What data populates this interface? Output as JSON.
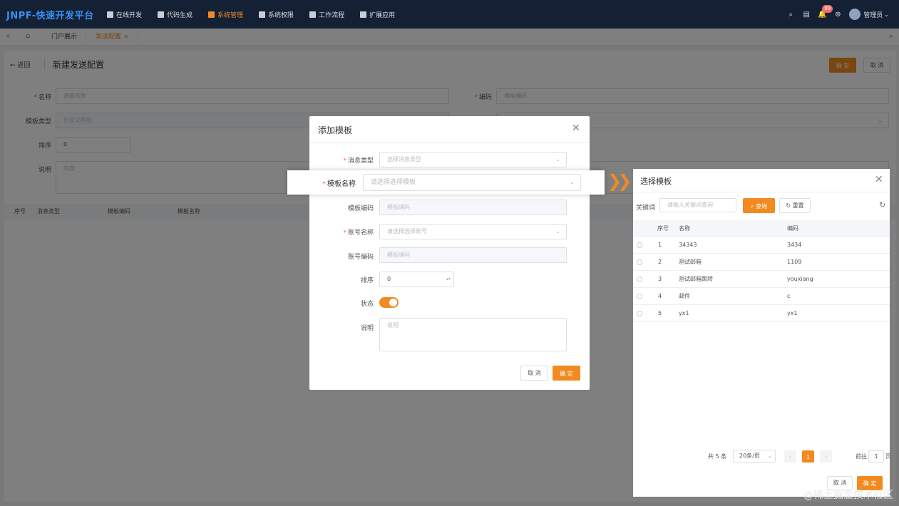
{
  "topbar": {
    "logo": "JNPF-快速开发平台",
    "nav": [
      "在线开发",
      "代码生成",
      "系统管理",
      "系统权限",
      "工作流程",
      "扩展应用"
    ],
    "active_index": 2,
    "notification_count": "99",
    "user": "管理员"
  },
  "tabs": [
    "门户展示",
    "发送配置"
  ],
  "page": {
    "back": "返回",
    "title": "新建发送配置",
    "confirm": "确 定",
    "cancel": "取 消",
    "form": {
      "name_label": "名称",
      "name_placeholder": "请输名称",
      "code_label": "编码",
      "code_placeholder": "模板编码",
      "template_type_label": "模板类型",
      "template_type_value": "自定义模板",
      "sort_label": "排序",
      "sort_value": "0",
      "desc_label": "说明",
      "desc_placeholder": "内容"
    },
    "table_headers": [
      "序号",
      "消息类型",
      "模板编码",
      "模板名称"
    ]
  },
  "dialog": {
    "title": "添加模板",
    "msg_type_label": "消息类型",
    "msg_type_placeholder": "选择消息类型",
    "tpl_name_label": "模板名称",
    "tpl_name_placeholder": "请选择选择模板",
    "tpl_code_label": "模板编码",
    "tpl_code_placeholder": "模板编码",
    "account_name_label": "账号名称",
    "account_name_placeholder": "请选择选择账号",
    "account_code_label": "账号编码",
    "account_code_placeholder": "模板编码",
    "sort_label": "排序",
    "sort_value": "0",
    "status_label": "状态",
    "status_on": true,
    "desc_label": "说明",
    "desc_placeholder": "说明",
    "cancel": "取 消",
    "confirm": "确 定"
  },
  "select_panel": {
    "title": "选择模板",
    "keyword_label": "关键词",
    "keyword_placeholder": "请输入关键词查询",
    "search": "查询",
    "reset": "重置",
    "headers": [
      "序号",
      "名称",
      "编码"
    ],
    "rows": [
      {
        "idx": "1",
        "name": "34343",
        "code": "3434"
      },
      {
        "idx": "2",
        "name": "测试邮箱",
        "code": "1109"
      },
      {
        "idx": "3",
        "name": "测试邮箱跳转",
        "code": "youxiang"
      },
      {
        "idx": "4",
        "name": "邮件",
        "code": "c"
      },
      {
        "idx": "5",
        "name": "yx1",
        "code": "yx1"
      }
    ],
    "total": "共 5 条",
    "page_size": "20条/页",
    "current_page": "1",
    "goto_label": "前往",
    "goto_value": "1",
    "page_unit": "页",
    "cancel": "取 消",
    "confirm": "确 定"
  },
  "watermark": "@稀土掘金技术社区",
  "colors": {
    "accent": "#f28a21",
    "topbar": "#142033",
    "logo": "#3a8ff2"
  }
}
